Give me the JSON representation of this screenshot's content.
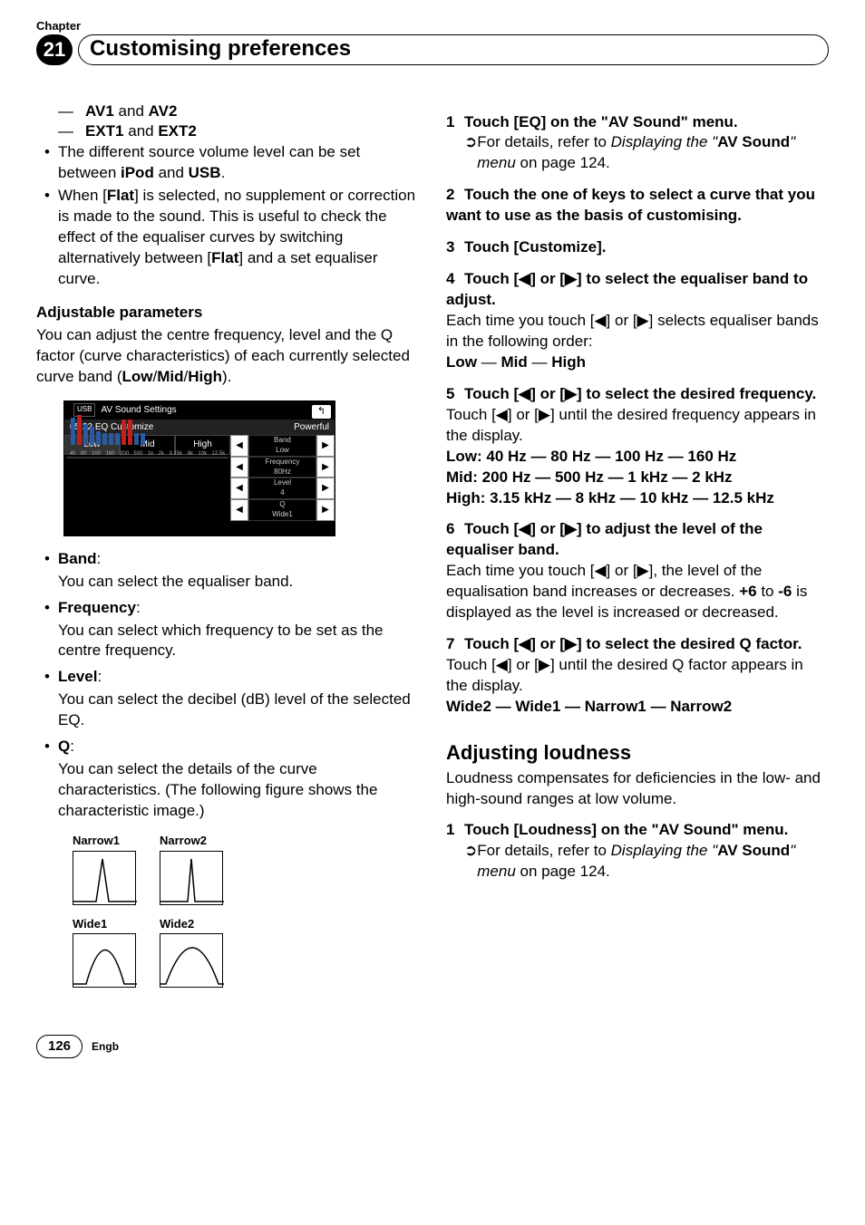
{
  "header": {
    "chapter_label": "Chapter",
    "chapter_num": "21",
    "title": "Customising preferences"
  },
  "left": {
    "av": {
      "a1": "AV1",
      "and1": " and ",
      "a2": "AV2"
    },
    "ext": {
      "e1": "EXT1",
      "and1": " and ",
      "e2": "EXT2"
    },
    "src_line": {
      "pre": "The different source volume level can be set between ",
      "ipod": "iPod",
      "and": " and ",
      "usb": "USB",
      "post": "."
    },
    "flat_line": {
      "pre": "When [",
      "flat1": "Flat",
      "mid": "] is selected, no supplement or correction is made to the sound. This is useful to check the effect of the equaliser curves by switching alternatively between [",
      "flat2": "Flat",
      "post": "] and a set equaliser curve."
    },
    "adj_params_h": "Adjustable parameters",
    "adj_params_p": {
      "pre": "You can adjust the centre frequency, level and the Q factor (curve characteristics) of each currently selected curve band (",
      "low": "Low",
      "s1": "/",
      "mid": "Mid",
      "s2": "/",
      "high": "High",
      "post": ")."
    },
    "screenshot": {
      "usb": "USB",
      "time": "05:32",
      "title": "AV Sound Settings",
      "sub": "EQ Customize",
      "mode": "Powerful",
      "tabs": [
        "Low",
        "Mid",
        "High"
      ],
      "xlabels": [
        "40",
        "80",
        "100",
        "160",
        "200",
        "500",
        "1k",
        "2k",
        "3.15k",
        "8k",
        "10k",
        "12.5k"
      ],
      "controls": [
        {
          "label": "Band",
          "val": "Low"
        },
        {
          "label": "Frequency",
          "val": "80Hz"
        },
        {
          "label": "Level",
          "val": "4"
        },
        {
          "label": "Q",
          "val": "Wide1"
        }
      ]
    },
    "terms": {
      "band": {
        "label": "Band",
        "desc": "You can select the equaliser band."
      },
      "freq": {
        "label": "Frequency",
        "desc": "You can select which frequency to be set as the centre frequency."
      },
      "level": {
        "label": "Level",
        "desc": "You can select the decibel (dB) level of the selected EQ."
      },
      "q": {
        "label": "Q",
        "desc": "You can select the details of the curve characteristics. (The following figure shows the characteristic image.)"
      }
    },
    "curves": {
      "n1": "Narrow1",
      "n2": "Narrow2",
      "w1": "Wide1",
      "w2": "Wide2"
    }
  },
  "right": {
    "s1": {
      "num": "1",
      "head": "Touch [EQ] on the \"AV Sound\" menu.",
      "ref_pre": "For details, refer to ",
      "ref_it1": "Displaying the \"",
      "ref_b": "AV Sound",
      "ref_it2": "\" menu",
      "ref_post": " on page 124."
    },
    "s2": {
      "num": "2",
      "head": "Touch the one of keys to select a curve that you want to use as the basis of customising."
    },
    "s3": {
      "num": "3",
      "head": "Touch [Customize]."
    },
    "s4": {
      "num": "4",
      "head": "Touch [◀] or [▶] to select the equaliser band to adjust.",
      "body": "Each time you touch [◀] or [▶] selects equaliser bands in the following order:",
      "order": {
        "low": "Low",
        "s1": " — ",
        "mid": "Mid",
        "s2": " — ",
        "high": "High"
      }
    },
    "s5": {
      "num": "5",
      "head": "Touch [◀] or [▶] to select the desired frequency.",
      "body": "Touch [◀] or [▶] until the desired frequency appears in the display.",
      "low": {
        "lbl": "Low",
        "v": ": 40 Hz — 80 Hz — 100 Hz — 160 Hz"
      },
      "mid": {
        "lbl": "Mid",
        "v": ": 200 Hz — 500 Hz — 1 kHz — 2 kHz"
      },
      "high": {
        "lbl": "High",
        "v": ": 3.15 kHz — 8 kHz — 10 kHz — 12.5 kHz"
      }
    },
    "s6": {
      "num": "6",
      "head": "Touch [◀] or [▶] to adjust the level of the equaliser band.",
      "body1": "Each time you touch [◀] or [▶], the level of the equalisation band increases or decreases. ",
      "p6": "+6",
      "to": " to ",
      "m6": "-6",
      "body2": " is displayed as the level is increased or decreased."
    },
    "s7": {
      "num": "7",
      "head": "Touch [◀] or [▶] to select the desired Q factor.",
      "body": "Touch [◀] or [▶] until the desired Q factor appears in the display.",
      "order": "Wide2 — Wide1 — Narrow1 — Narrow2"
    },
    "loud": {
      "h": "Adjusting loudness",
      "p": "Loudness compensates for deficiencies in the low- and high-sound ranges at low volume.",
      "num": "1",
      "head": "Touch [Loudness] on the \"AV Sound\" menu.",
      "ref_pre": "For details, refer to ",
      "ref_it1": "Displaying the \"",
      "ref_b": "AV Sound",
      "ref_it2": "\" menu",
      "ref_post": " on page 124."
    }
  },
  "footer": {
    "page": "126",
    "lang": "Engb"
  },
  "glyphs": {
    "dash": "—",
    "bullet": "•",
    "ref": "➲",
    "back": "↰",
    "left": "◀",
    "right": "▶"
  }
}
